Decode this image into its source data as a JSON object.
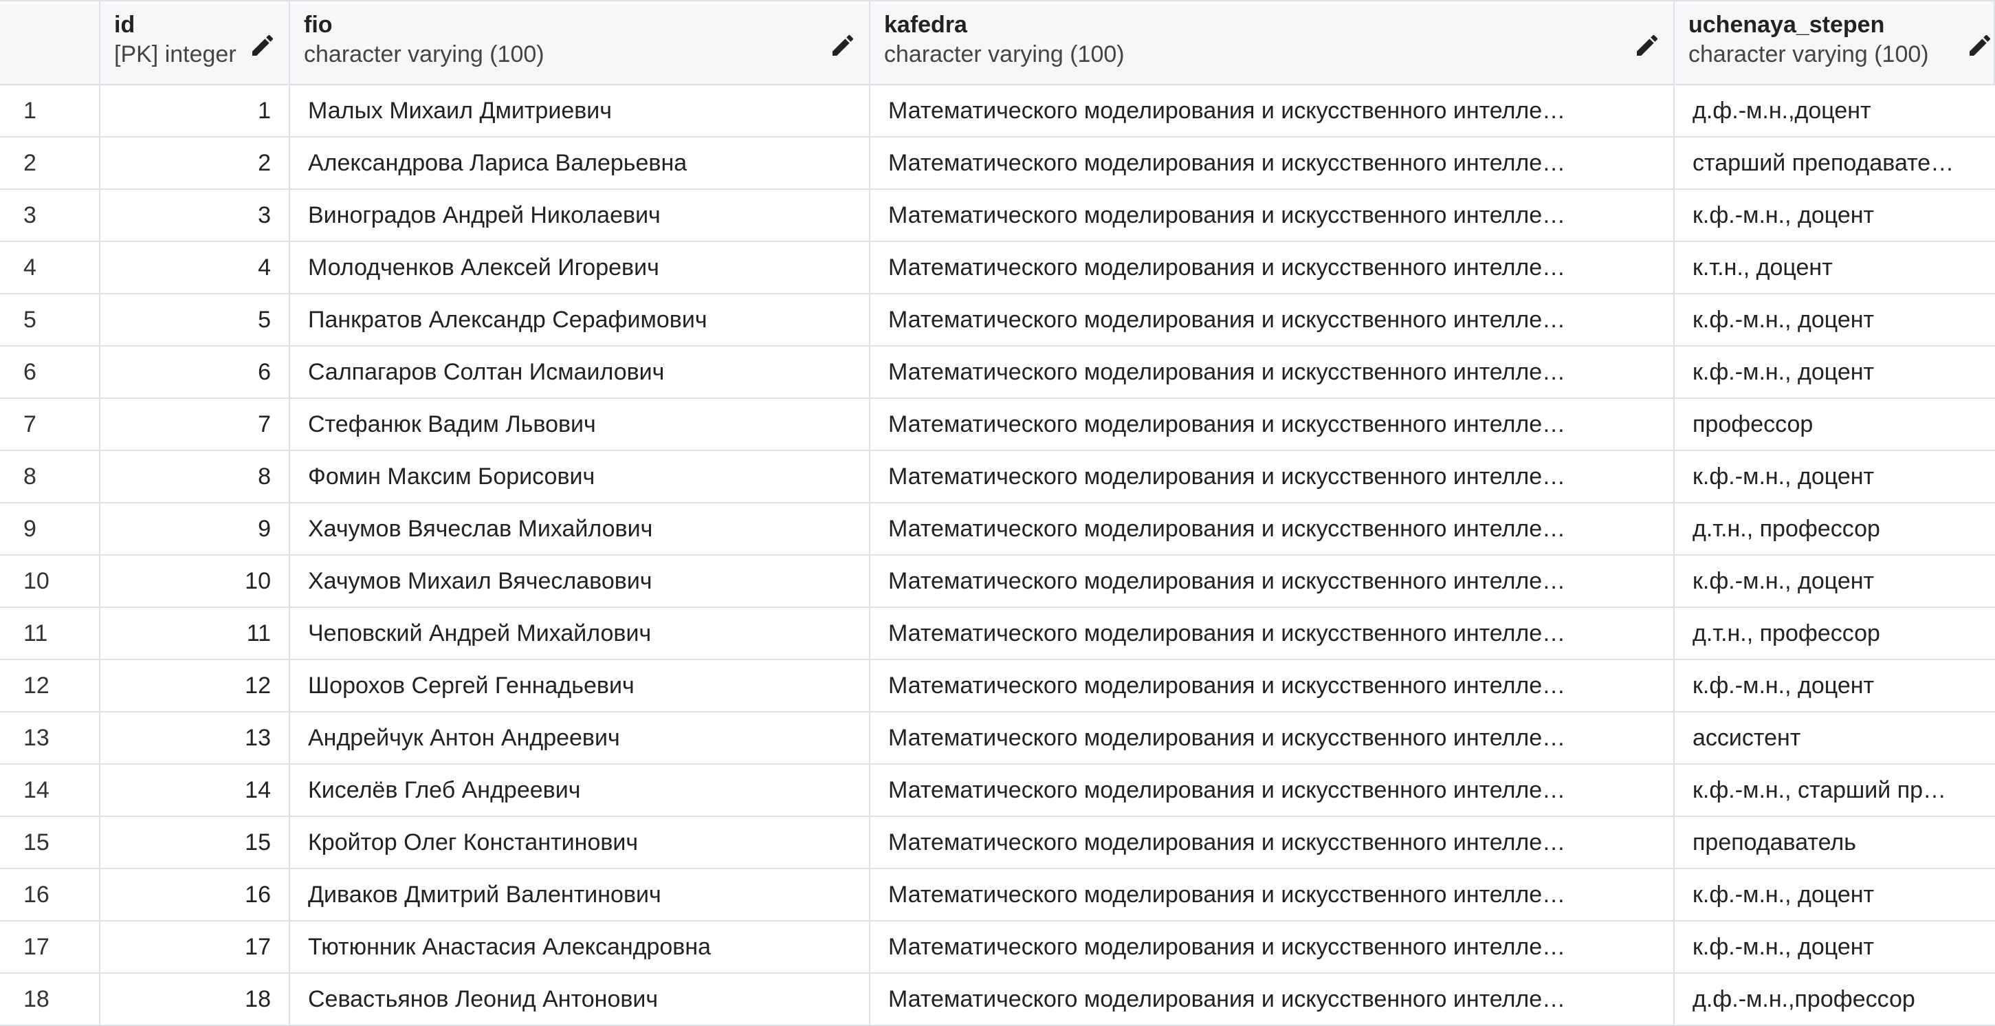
{
  "columns": [
    {
      "name": "id",
      "type": "[PK] integer"
    },
    {
      "name": "fio",
      "type": "character varying (100)"
    },
    {
      "name": "kafedra",
      "type": "character varying (100)"
    },
    {
      "name": "uchenaya_stepen",
      "type": "character varying (100)"
    }
  ],
  "rows": [
    {
      "n": "1",
      "id": "1",
      "fio": "Малых Михаил Дмитриевич",
      "kafedra": "Математического моделирования и искусственного интелле…",
      "stepen": "д.ф.-м.н.,доцент"
    },
    {
      "n": "2",
      "id": "2",
      "fio": "Александрова Лариса Валерьевна",
      "kafedra": "Математического моделирования и искусственного интелле…",
      "stepen": "старший преподавате…"
    },
    {
      "n": "3",
      "id": "3",
      "fio": "Виноградов Андрей Николаевич",
      "kafedra": "Математического моделирования и искусственного интелле…",
      "stepen": "к.ф.-м.н., доцент"
    },
    {
      "n": "4",
      "id": "4",
      "fio": "Молодченков Алексей Игоревич",
      "kafedra": "Математического моделирования и искусственного интелле…",
      "stepen": "к.т.н., доцент"
    },
    {
      "n": "5",
      "id": "5",
      "fio": "Панкратов Александр Серафимович",
      "kafedra": "Математического моделирования и искусственного интелле…",
      "stepen": "к.ф.-м.н., доцент"
    },
    {
      "n": "6",
      "id": "6",
      "fio": "Салпагаров Солтан Исмаилович",
      "kafedra": "Математического моделирования и искусственного интелле…",
      "stepen": "к.ф.-м.н., доцент"
    },
    {
      "n": "7",
      "id": "7",
      "fio": "Стефанюк Вадим Львович",
      "kafedra": "Математического моделирования и искусственного интелле…",
      "stepen": "профессор"
    },
    {
      "n": "8",
      "id": "8",
      "fio": "Фомин Максим Борисович",
      "kafedra": "Математического моделирования и искусственного интелле…",
      "stepen": "к.ф.-м.н., доцент"
    },
    {
      "n": "9",
      "id": "9",
      "fio": "Хачумов Вячеслав Михайлович",
      "kafedra": "Математического моделирования и искусственного интелле…",
      "stepen": "д.т.н., профессор"
    },
    {
      "n": "10",
      "id": "10",
      "fio": "Хачумов Михаил Вячеславович",
      "kafedra": "Математического моделирования и искусственного интелле…",
      "stepen": "к.ф.-м.н., доцент"
    },
    {
      "n": "11",
      "id": "11",
      "fio": "Чеповский Андрей Михайлович",
      "kafedra": "Математического моделирования и искусственного интелле…",
      "stepen": "д.т.н., профессор"
    },
    {
      "n": "12",
      "id": "12",
      "fio": "Шорохов Сергей Геннадьевич",
      "kafedra": "Математического моделирования и искусственного интелле…",
      "stepen": "к.ф.-м.н., доцент"
    },
    {
      "n": "13",
      "id": "13",
      "fio": "Андрейчук Антон Андреевич",
      "kafedra": "Математического моделирования и искусственного интелле…",
      "stepen": "ассистент"
    },
    {
      "n": "14",
      "id": "14",
      "fio": "Киселёв Глеб Андреевич",
      "kafedra": "Математического моделирования и искусственного интелле…",
      "stepen": "к.ф.-м.н., старший пр…"
    },
    {
      "n": "15",
      "id": "15",
      "fio": "Кройтор Олег Константинович",
      "kafedra": "Математического моделирования и искусственного интелле…",
      "stepen": "преподаватель"
    },
    {
      "n": "16",
      "id": "16",
      "fio": "Диваков Дмитрий Валентинович",
      "kafedra": "Математического моделирования и искусственного интелле…",
      "stepen": "к.ф.-м.н., доцент"
    },
    {
      "n": "17",
      "id": "17",
      "fio": "Тютюнник Анастасия Александровна",
      "kafedra": "Математического моделирования и искусственного интелле…",
      "stepen": "к.ф.-м.н., доцент"
    },
    {
      "n": "18",
      "id": "18",
      "fio": "Севастьянов Леонид Антонович",
      "kafedra": "Математического моделирования и искусственного интелле…",
      "stepen": "д.ф.-м.н.,профессор"
    }
  ]
}
